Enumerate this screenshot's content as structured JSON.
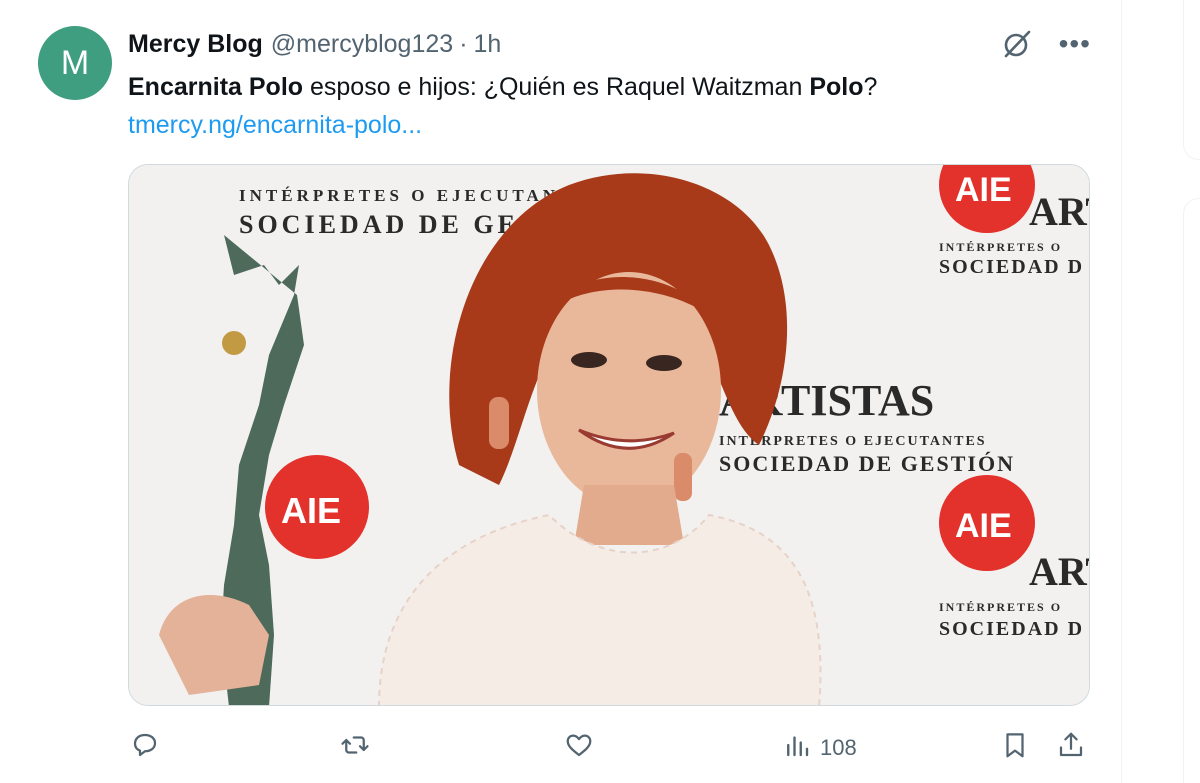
{
  "tweet": {
    "avatar_letter": "M",
    "author_name": "Mercy Blog",
    "handle": "@mercyblog123",
    "separator": "·",
    "time": "1h",
    "text_parts": [
      {
        "text": "Encarnita Polo",
        "bold": true
      },
      {
        "text": " esposo e hijos: ¿Quién es Raquel Waitzman ",
        "bold": false
      },
      {
        "text": "Polo",
        "bold": true
      },
      {
        "text": "?",
        "bold": false
      }
    ],
    "link": "tmercy.ng/encarnita-polo...",
    "media": {
      "backdrop_texts": [
        "INTÉRPRETES O EJECUTANTES",
        "SOCIEDAD DE GESTIÓN",
        "ARTISTAS",
        "AIE",
        "ART",
        "INTÉRPRETES O",
        "SOCIEDAD D",
        "ARTISTAS",
        "INTÉRPRETES O EJECUTANTES",
        "SOCIEDAD DE GESTIÓN",
        "AIE",
        "ART",
        "INTÉRPRETES O",
        "SOCIEDAD D",
        "AIE"
      ]
    },
    "actions": {
      "reply_count": "",
      "retweet_count": "",
      "like_count": "",
      "views_count": "108"
    }
  },
  "colors": {
    "avatar_bg": "#3f9e7f",
    "link": "#1d9bf0",
    "muted": "#536471",
    "aie_red": "#e3312c",
    "hair": "#a83a1a"
  },
  "icons": [
    "grok-icon",
    "more-icon",
    "reply-icon",
    "retweet-icon",
    "like-icon",
    "views-icon",
    "bookmark-icon",
    "share-icon"
  ]
}
